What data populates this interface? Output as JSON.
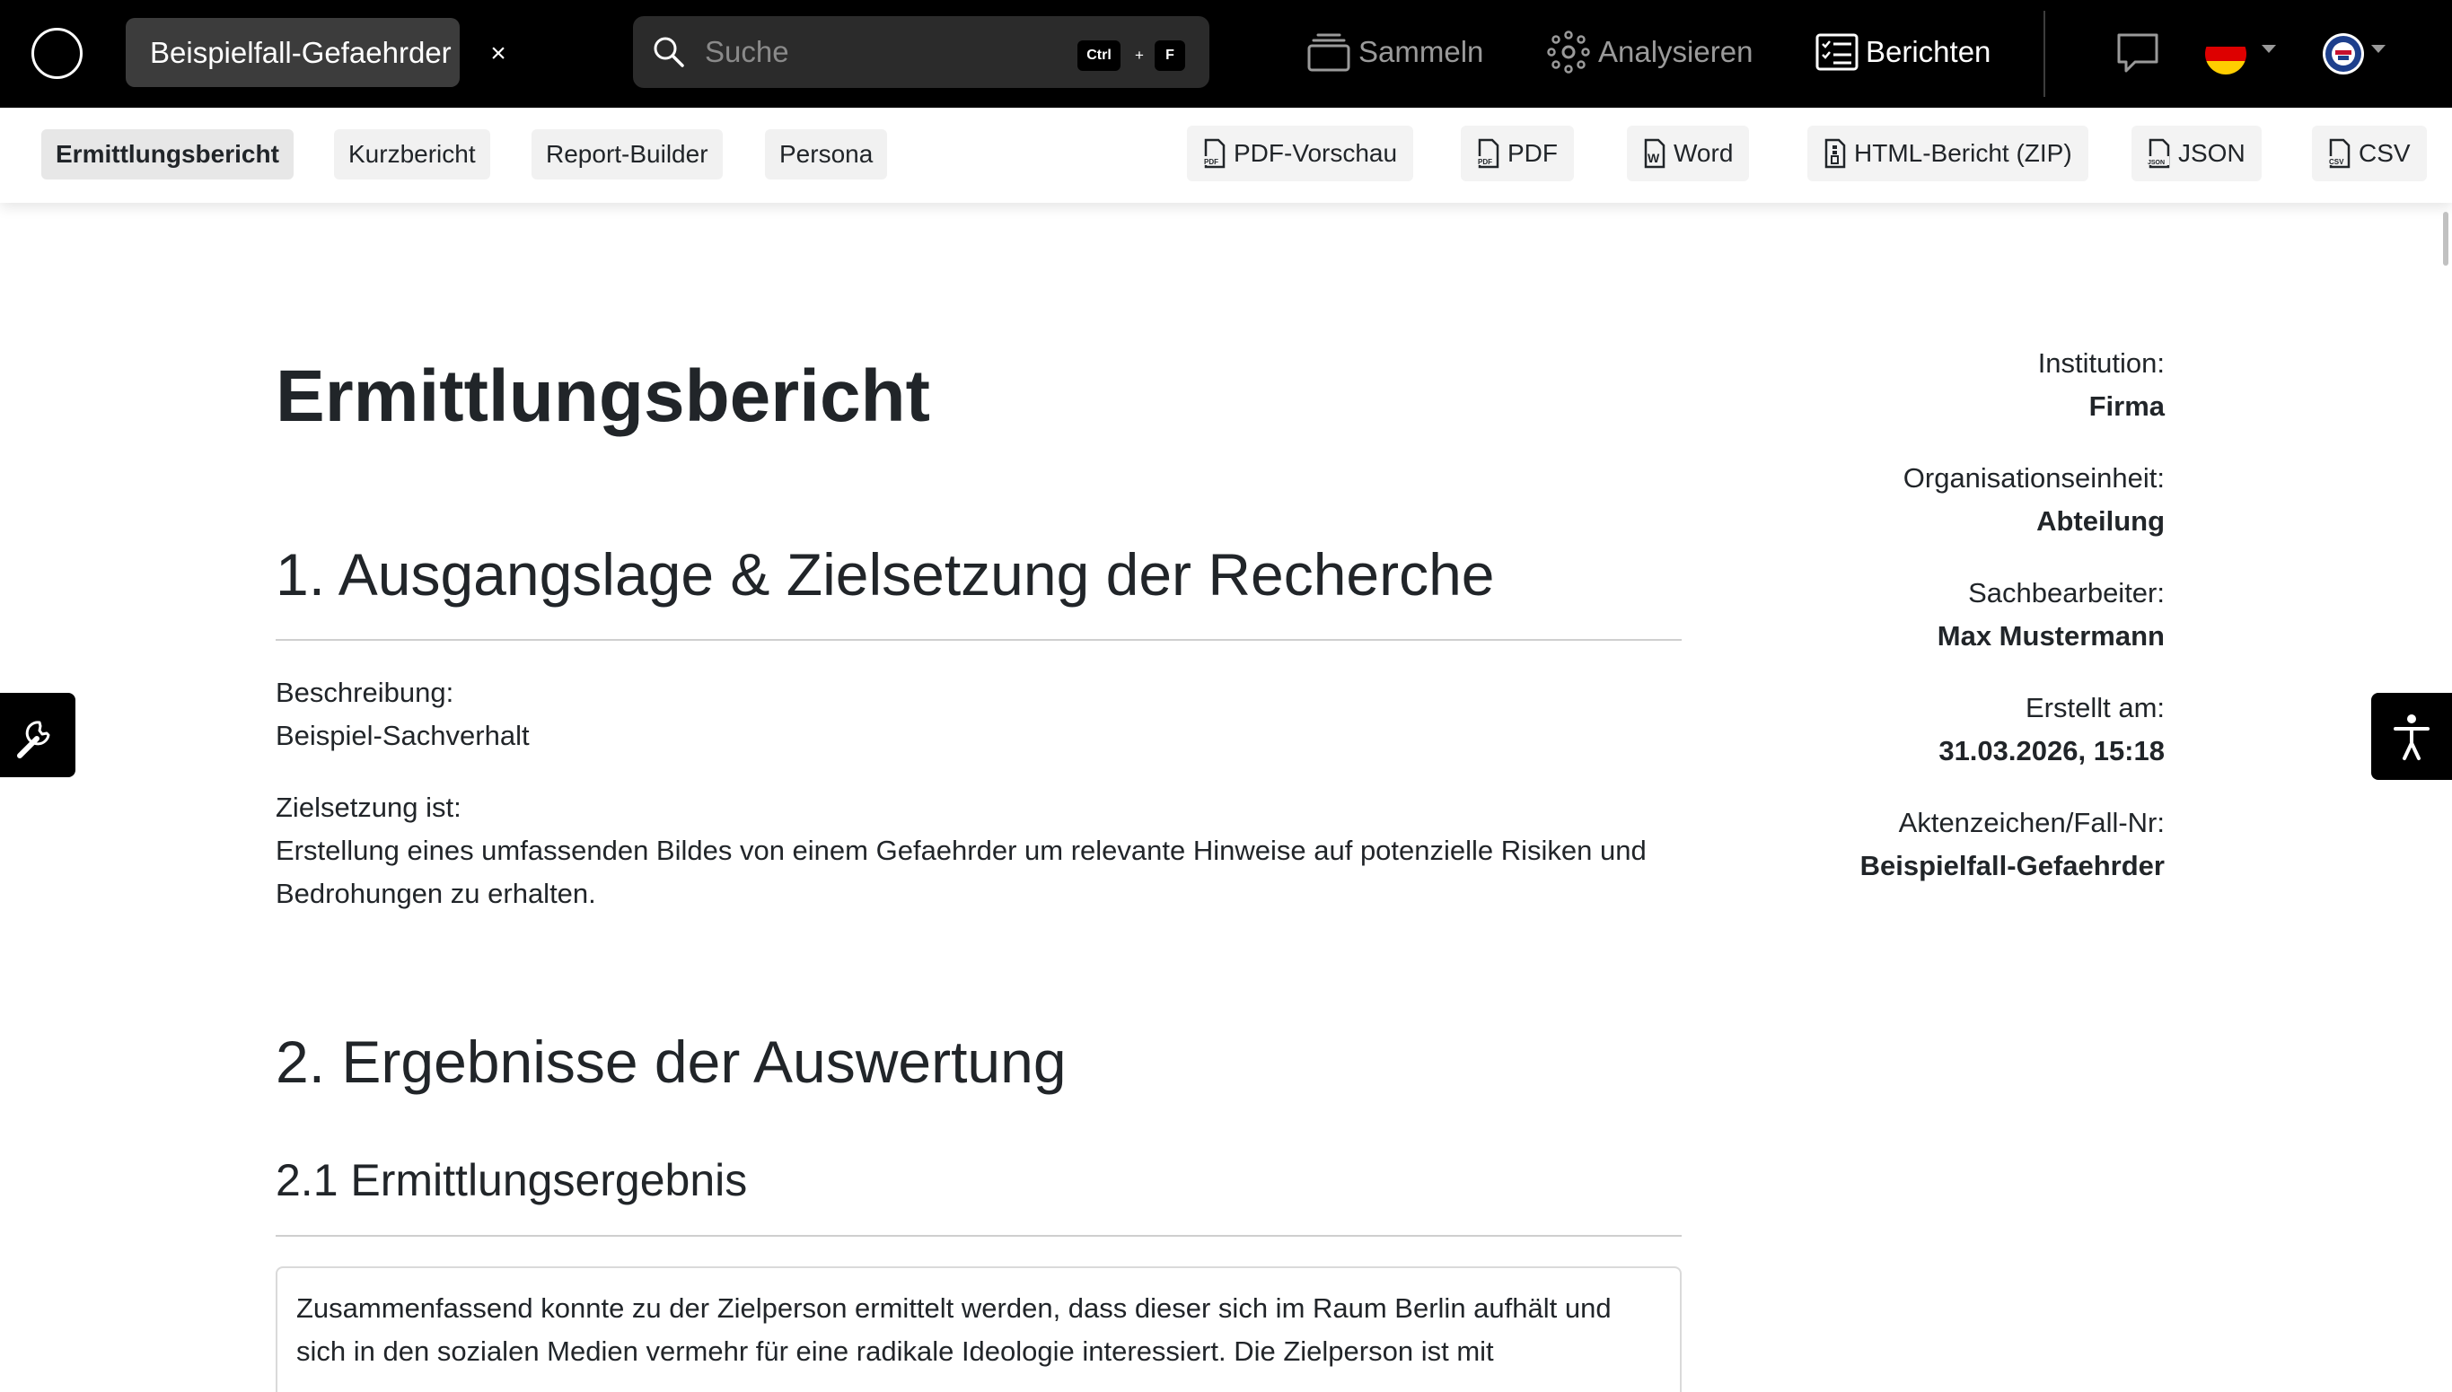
{
  "topbar": {
    "case_name": "Beispielfall-Gefaehrder",
    "close_label": "×",
    "search": {
      "placeholder": "Suche",
      "shortcut_key1": "Ctrl",
      "shortcut_plus": "+",
      "shortcut_key2": "F"
    },
    "nav": [
      {
        "label": "Sammeln",
        "icon": "stack-icon",
        "active": false
      },
      {
        "label": "Analysieren",
        "icon": "network-icon",
        "active": false
      },
      {
        "label": "Berichten",
        "icon": "report-list-icon",
        "active": true
      }
    ],
    "language": "de",
    "colors": {
      "background": "#000000",
      "inactive": "#9a9a9a",
      "active": "#ffffff"
    }
  },
  "toolbar": {
    "tabs": [
      {
        "label": "Ermittlungsbericht",
        "active": true
      },
      {
        "label": "Kurzbericht",
        "active": false
      },
      {
        "label": "Report-Builder",
        "active": false
      },
      {
        "label": "Persona",
        "active": false
      }
    ],
    "exports": [
      {
        "label": "PDF-Vorschau",
        "icon": "pdf-file-icon"
      },
      {
        "label": "PDF",
        "icon": "pdf-file-icon"
      },
      {
        "label": "Word",
        "icon": "word-file-icon"
      },
      {
        "label": "HTML-Bericht (ZIP)",
        "icon": "zip-file-icon"
      },
      {
        "label": "JSON",
        "icon": "json-file-icon"
      },
      {
        "label": "CSV",
        "icon": "csv-file-icon"
      }
    ]
  },
  "report": {
    "title": "Ermittlungsbericht",
    "section1": {
      "heading": "1. Ausgangslage & Zielsetzung der Recherche",
      "description_label": "Beschreibung:",
      "description_value": "Beispiel-Sachverhalt",
      "goal_label": "Zielsetzung ist:",
      "goal_value": "Erstellung eines umfassenden Bildes von einem Gefaehrder um relevante Hinweise auf potenzielle Risiken und Bedrohungen zu erhalten."
    },
    "section2": {
      "heading": "2. Ergebnisse der Auswertung",
      "sub1_heading": "2.1 Ermittlungsergebnis",
      "summary": "Zusammenfassend konnte zu der Zielperson ermittelt werden, dass dieser sich im Raum Berlin aufhält und sich in den sozialen Medien vermehr für eine radikale Ideologie interessiert. Die Zielperson ist mit"
    }
  },
  "meta": {
    "institution_label": "Institution:",
    "institution_value": "Firma",
    "unit_label": "Organisationseinheit:",
    "unit_value": "Abteilung",
    "officer_label": "Sachbearbeiter:",
    "officer_value": "Max Mustermann",
    "created_label": "Erstellt am:",
    "created_value": "31.03.2026, 15:18",
    "case_label": "Aktenzeichen/Fall-Nr:",
    "case_value": "Beispielfall-Gefaehrder"
  }
}
